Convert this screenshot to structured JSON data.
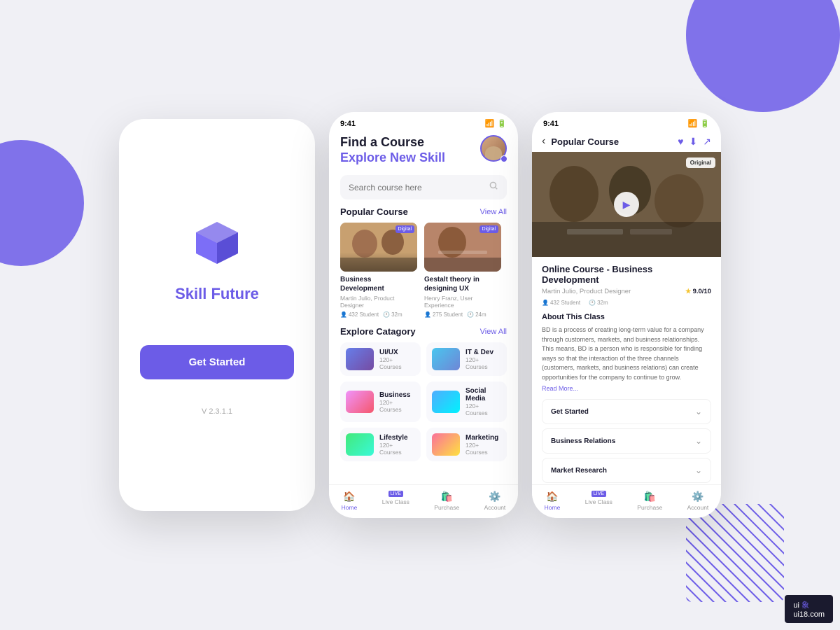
{
  "background": {
    "color": "#f0f0f5"
  },
  "watermark": {
    "line1": "ui 象",
    "line2": "ui18.com"
  },
  "splash": {
    "app_name": "Skill Future",
    "logo_label": "skill-future-logo",
    "get_started": "Get Started",
    "version": "V 2.3.1.1"
  },
  "home": {
    "status_time": "9:41",
    "greeting_line1": "Find a Course",
    "greeting_line2_prefix": "Explore ",
    "greeting_line2_highlight": "New Skill",
    "search_placeholder": "Search course here",
    "popular_section": "Popular Course",
    "view_all_1": "View All",
    "courses": [
      {
        "title": "Business Development",
        "author": "Martin Julio, Product Designer",
        "students": "432 Student",
        "duration": "32m",
        "badge": "Digital"
      },
      {
        "title": "Gestalt theory in designing UX",
        "author": "Henry Franz, User Experience",
        "students": "275 Student",
        "duration": "24m",
        "badge": "Digital"
      }
    ],
    "explore_section": "Explore Catagory",
    "view_all_2": "View All",
    "categories": [
      {
        "name": "UI/UX",
        "count": "120+ Courses",
        "style": "cat-uiux"
      },
      {
        "name": "IT & Dev",
        "count": "120+ Courses",
        "style": "cat-itdev"
      },
      {
        "name": "Business",
        "count": "120+ Courses",
        "style": "cat-business"
      },
      {
        "name": "Social Media",
        "count": "120+ Courses",
        "style": "cat-social"
      },
      {
        "name": "Lifestyle",
        "count": "120+ Courses",
        "style": "cat-lifestyle"
      },
      {
        "name": "Marketing",
        "count": "120+ Courses",
        "style": "cat-marketing"
      }
    ],
    "nav": [
      {
        "label": "Home",
        "active": true
      },
      {
        "label": "Live Class",
        "live": true
      },
      {
        "label": "Purchase"
      },
      {
        "label": "Account"
      }
    ]
  },
  "detail": {
    "status_time": "9:41",
    "header_title": "Popular Course",
    "original_badge": "Original",
    "course_title": "Online Course - Business Development",
    "author": "Martin Julio, Product Designer",
    "rating": "9.0/10",
    "students": "432 Student",
    "duration": "32m",
    "about_title": "About This Class",
    "about_text": "BD is a process of creating long-term value for a company through customers, markets, and business relationships. This means, BD is a person who is responsible for finding ways so that the interaction of the three channels (customers, markets, and business relations) can create opportunities for the company to continue to grow.",
    "read_more": "Read More...",
    "accordions": [
      {
        "label": "Get Started"
      },
      {
        "label": "Business Relations"
      },
      {
        "label": "Market Research"
      }
    ],
    "nav": [
      {
        "label": "Home",
        "active": true
      },
      {
        "label": "Live Class",
        "live": true
      },
      {
        "label": "Purchase"
      },
      {
        "label": "Account"
      }
    ]
  }
}
